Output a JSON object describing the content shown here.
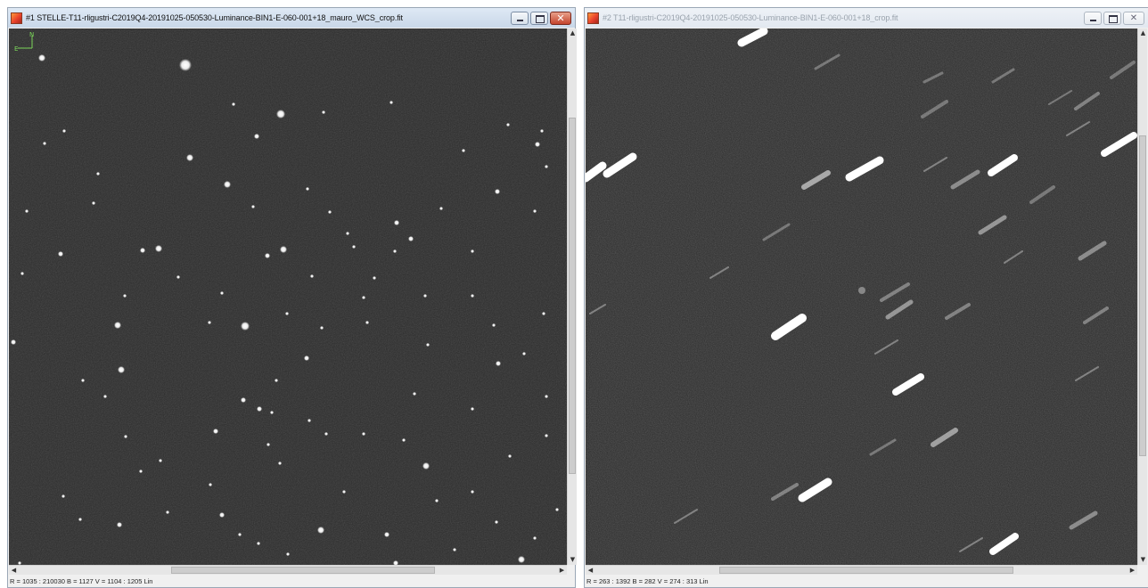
{
  "windows": [
    {
      "title": "#1 STELLE-T11-rligustri-C2019Q4-20191025-050530-Luminance-BIN1-E-060-001+18_mauro_WCS_crop.fit",
      "status": "R = 1035 : 210030   B = 1127   V = 1104 : 1205 Lin",
      "icons": [
        "app-icon",
        "minimize-icon",
        "maximize-icon",
        "close-icon"
      ],
      "compass": {
        "north_label": "N",
        "east_label": "E"
      }
    },
    {
      "title": "#2 T11-rligustri-C2019Q4-20191025-050530-Luminance-BIN1-E-060-001+18_crop.fit",
      "status": "R = 263 : 1392   B = 282   V = 274 : 313 Lin",
      "icons": [
        "app-icon",
        "minimize-icon",
        "maximize-icon",
        "close-icon"
      ]
    }
  ],
  "colors": {
    "sky_background": "#2b2b2b",
    "star": "#ffffff",
    "active_title_bar": "#c9d7e8",
    "inactive_title_bar": "#e2e8f0",
    "close_button_active": "#c4432c",
    "compass": "#7cd65a"
  }
}
